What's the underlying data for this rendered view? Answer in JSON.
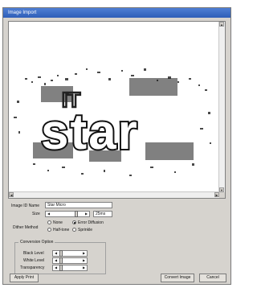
{
  "window": {
    "title": "Image Import"
  },
  "preview": {
    "logo_text": "star",
    "logo_tagline": "IT"
  },
  "form": {
    "image_id_label": "Image ID Name",
    "image_id_value": "Star Micro",
    "size_label": "Size",
    "size_value": "25ms",
    "dither_label": "Dither Method",
    "dither_options": [
      "None",
      "Error Diffusion",
      "Half-tone",
      "Sprinkle"
    ],
    "dither_selected": "Error Diffusion"
  },
  "conversion": {
    "legend": "Conversion Option",
    "rows": [
      {
        "label": "Black Level"
      },
      {
        "label": "White Level"
      },
      {
        "label": "Transparency"
      }
    ]
  },
  "buttons": {
    "left": "Apply Print",
    "convert": "Convert Image",
    "cancel": "Cancel"
  },
  "colors": {
    "title_bar": "#2f5fb8",
    "dialog_bg": "#d6d3ce"
  }
}
